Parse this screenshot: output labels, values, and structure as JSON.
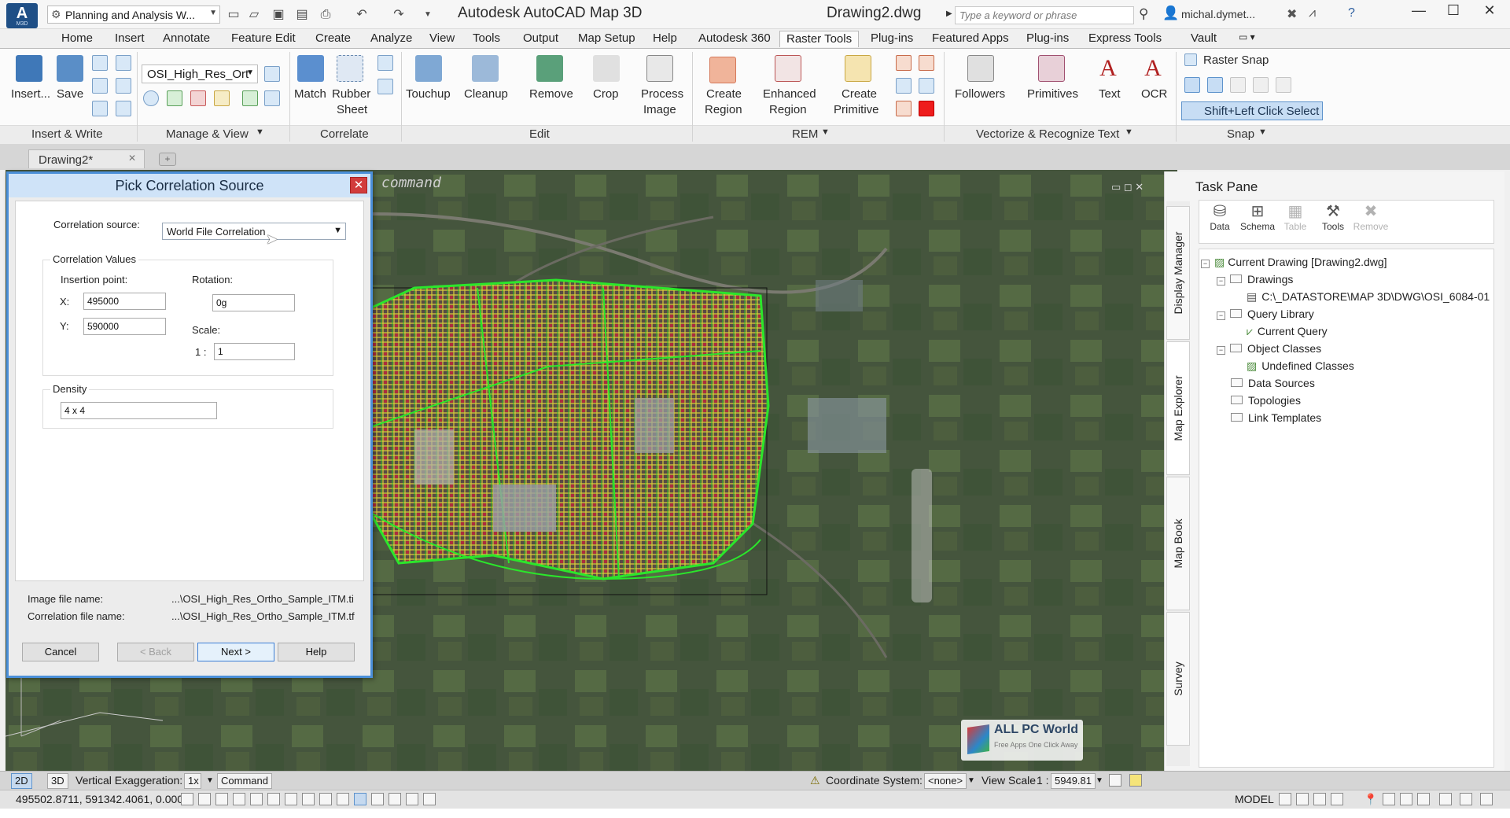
{
  "titlebar": {
    "workspace": "Planning and Analysis W...",
    "app_title": "Autodesk AutoCAD Map 3D",
    "doc_title": "Drawing2.dwg",
    "search_placeholder": "Type a keyword or phrase",
    "user_name": "michal.dymet..."
  },
  "ribbon_tabs": [
    "Home",
    "Insert",
    "Annotate",
    "Feature Edit",
    "Create",
    "Analyze",
    "View",
    "Tools",
    "Output",
    "Map Setup",
    "Help",
    "Autodesk 360",
    "Raster Tools",
    "Plug-ins",
    "Featured Apps",
    "Plug-ins",
    "Express Tools",
    "Vault"
  ],
  "ribbon_tab_active": "Raster Tools",
  "ribbon": {
    "insert": "Insert...",
    "save": "Save",
    "image_dropdown": "OSI_High_Res_Ort",
    "match": "Match",
    "rubber_sheet_1": "Rubber",
    "rubber_sheet_2": "Sheet",
    "touchup": "Touchup",
    "cleanup": "Cleanup",
    "remove": "Remove",
    "crop": "Crop",
    "process_image_1": "Process",
    "process_image_2": "Image",
    "create_region_1": "Create",
    "create_region_2": "Region",
    "enhanced_region_1": "Enhanced",
    "enhanced_region_2": "Region",
    "create_primitive_1": "Create",
    "create_primitive_2": "Primitive",
    "followers": "Followers",
    "primitives": "Primitives",
    "text": "Text",
    "ocr": "OCR",
    "raster_snap": "Raster Snap",
    "shift_left_click": "Shift+Left Click Select",
    "panels": [
      "Insert & Write",
      "Manage & View",
      "Correlate",
      "Edit",
      "REM",
      "Vectorize & Recognize Text",
      "Snap"
    ]
  },
  "doc_tab": "Drawing2*",
  "drawing": {
    "command_ghost": "command"
  },
  "watermark": {
    "title": "ALL PC World",
    "subtitle": "Free Apps One Click Away"
  },
  "dialog": {
    "title": "Pick Correlation Source",
    "correlation_source_label": "Correlation source:",
    "correlation_source_value": "World File Correlation",
    "correlation_values_label": "Correlation Values",
    "insertion_point_label": "Insertion point:",
    "x_label": "X:",
    "x_value": "495000",
    "y_label": "Y:",
    "y_value": "590000",
    "rotation_label": "Rotation:",
    "rotation_value": "0g",
    "scale_label": "Scale:",
    "scale_prefix": "1 :",
    "scale_value": "1",
    "density_label": "Density",
    "density_value": "4 x 4",
    "image_file_label": "Image file name:",
    "image_file_value": "...\\OSI_High_Res_Ortho_Sample_ITM.ti",
    "correlation_file_label": "Correlation file name:",
    "correlation_file_value": "...\\OSI_High_Res_Ortho_Sample_ITM.tf",
    "cancel": "Cancel",
    "back": "< Back",
    "next": "Next >",
    "help": "Help"
  },
  "task_pane": {
    "title": "Task Pane",
    "tools": [
      "Data",
      "Schema",
      "Table",
      "Tools",
      "Remove"
    ],
    "tree": {
      "root": "Current Drawing [Drawing2.dwg]",
      "drawings": "Drawings",
      "drawing_path": "C:\\_DATASTORE\\MAP 3D\\DWG\\OSI_6084-01",
      "query_library": "Query Library",
      "current_query": "Current Query",
      "object_classes": "Object Classes",
      "undefined_classes": "Undefined Classes",
      "data_sources": "Data Sources",
      "topologies": "Topologies",
      "link_templates": "Link Templates"
    },
    "side_tabs": [
      "Display Manager",
      "Map Explorer",
      "Map Book",
      "Survey"
    ]
  },
  "status1": {
    "mode_2d": "2D",
    "mode_3d": "3D",
    "vert_exag_label": "Vertical Exaggeration:",
    "vert_exag_value": "1x",
    "command": "Command",
    "coord_sys_label": "Coordinate System:",
    "coord_sys_value": "<none>",
    "view_scale_label": "View Scale",
    "view_scale_prefix": "1 :",
    "view_scale_value": "5949.81"
  },
  "status2": {
    "coordinates": "495502.8711, 591342.4061, 0.0000",
    "model": "MODEL"
  }
}
